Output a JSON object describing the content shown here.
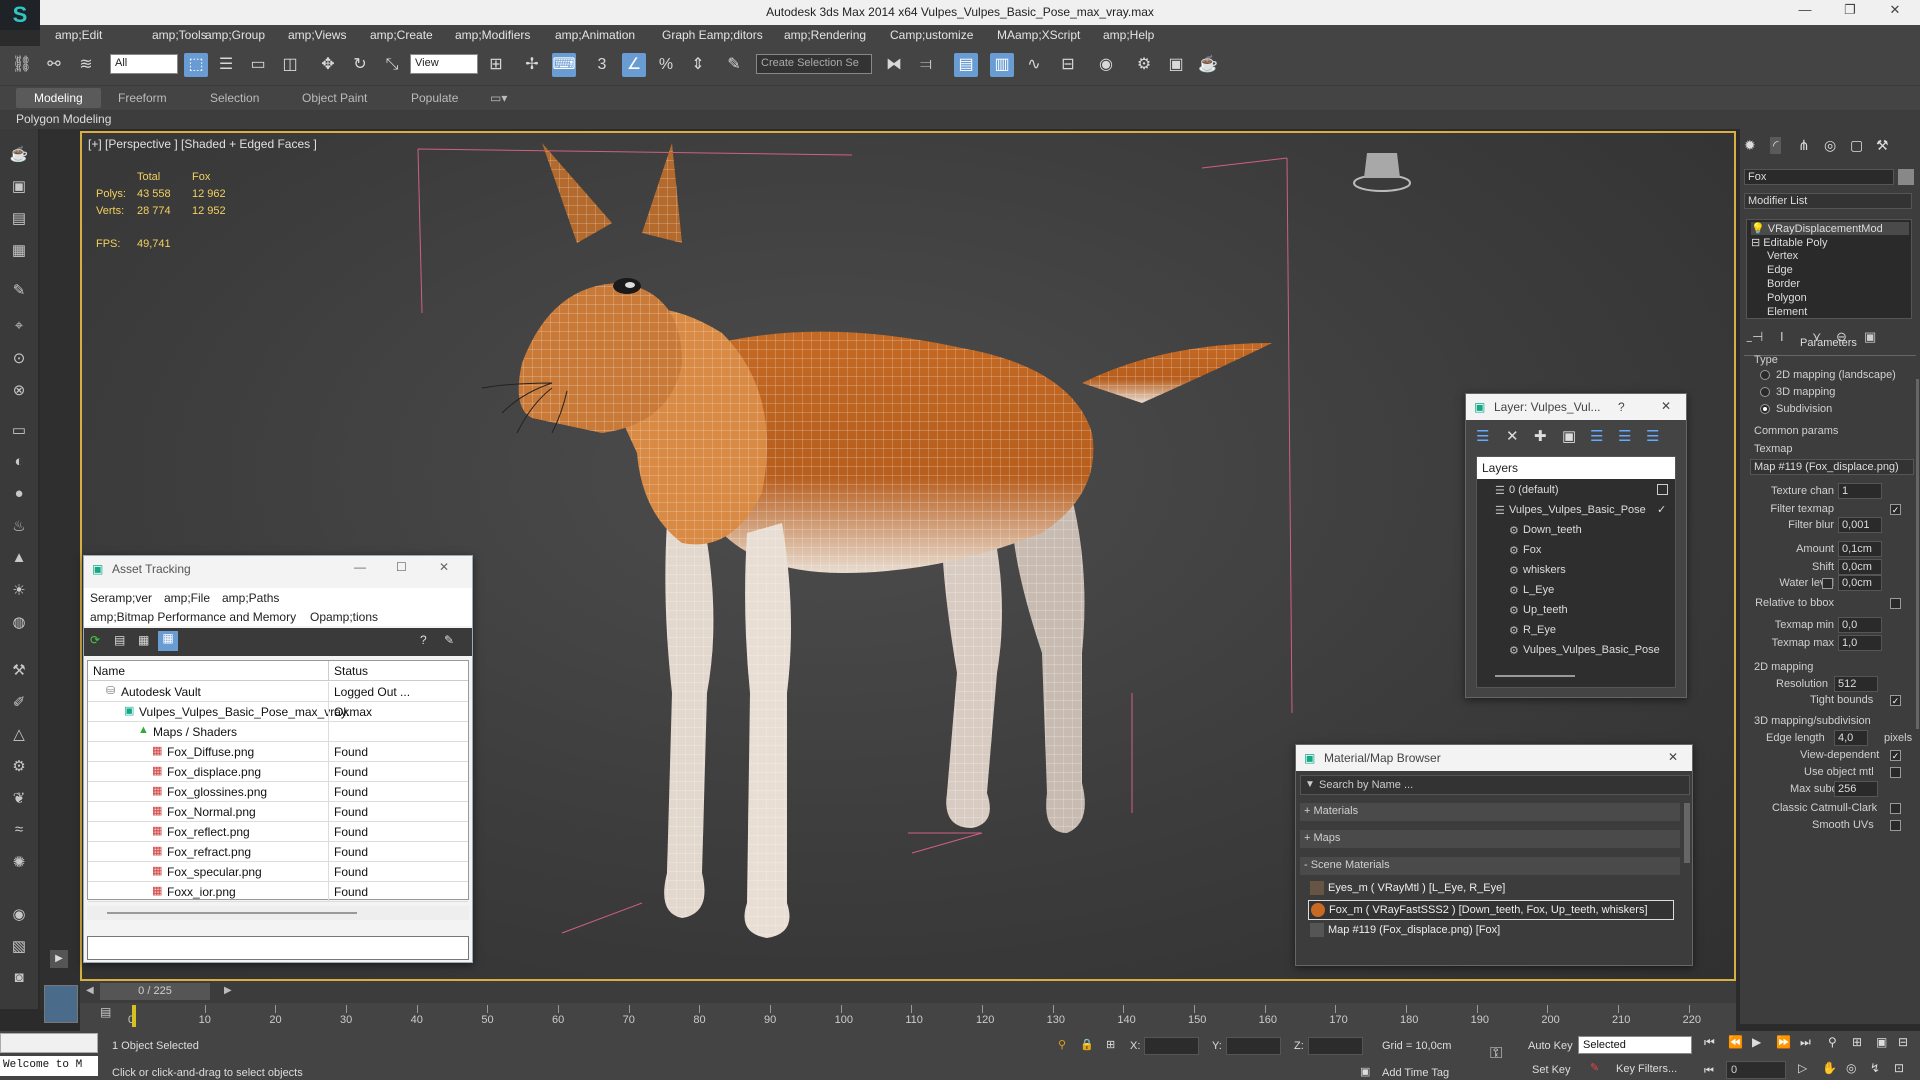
{
  "window": {
    "title": "Autodesk 3ds Max  2014 x64     Vulpes_Vulpes_Basic_Pose_max_vray.max",
    "logo": "3ds-max-logo-icon"
  },
  "menu": [
    "amp;Edit",
    "amp;Tools",
    "amp;Group",
    "amp;Views",
    "amp;Create",
    "amp;Modifiers",
    "amp;Animation",
    "Graph Eamp;ditors",
    "amp;Rendering",
    "Camp;ustomize",
    "MAamp;XScript",
    "amp;Help"
  ],
  "toolbar": {
    "filter": "All",
    "refcoord": "View",
    "selset": "Create Selection Se"
  },
  "ribbon": {
    "tabs": [
      "Modeling",
      "Freeform",
      "Selection",
      "Object Paint",
      "Populate"
    ],
    "sub": "Polygon Modeling"
  },
  "viewport": {
    "label": "[+] [Perspective ] [Shaded + Edged Faces ]",
    "stats": {
      "col1": "Total",
      "col2": "Fox",
      "polys_label": "Polys:",
      "polys_total": "43 558",
      "polys_fox": "12 962",
      "verts_label": "Verts:",
      "verts_total": "28 774",
      "verts_fox": "12 952",
      "fps_label": "FPS:",
      "fps": "49,741"
    }
  },
  "asset_tracking": {
    "title": "Asset Tracking",
    "menus": [
      "Seramp;ver",
      "amp;File",
      "amp;Paths",
      "amp;Bitmap Performance and Memory",
      "Opamp;tions"
    ],
    "columns": [
      "Name",
      "Status"
    ],
    "rows": [
      {
        "name": "Autodesk Vault",
        "status": "Logged Out ..."
      },
      {
        "name": "Vulpes_Vulpes_Basic_Pose_max_vray.max",
        "status": "Ok"
      },
      {
        "name": "Maps / Shaders",
        "status": ""
      },
      {
        "name": "Fox_Diffuse.png",
        "status": "Found"
      },
      {
        "name": "Fox_displace.png",
        "status": "Found"
      },
      {
        "name": "Fox_glossines.png",
        "status": "Found"
      },
      {
        "name": "Fox_Normal.png",
        "status": "Found"
      },
      {
        "name": "Fox_reflect.png",
        "status": "Found"
      },
      {
        "name": "Fox_refract.png",
        "status": "Found"
      },
      {
        "name": "Fox_specular.png",
        "status": "Found"
      },
      {
        "name": "Foxx_ior.png",
        "status": "Found"
      }
    ]
  },
  "layer_dialog": {
    "title": "Layer: Vulpes_Vul...",
    "help": "?",
    "header": "Layers",
    "items": [
      "0 (default)",
      "Vulpes_Vulpes_Basic_Pose",
      "Down_teeth",
      "Fox",
      "whiskers",
      "L_Eye",
      "Up_teeth",
      "R_Eye",
      "Vulpes_Vulpes_Basic_Pose"
    ]
  },
  "material_browser": {
    "title": "Material/Map Browser",
    "search_placeholder": "Search by Name ...",
    "groups": [
      "+ Materials",
      "+ Maps",
      "- Scene Materials"
    ],
    "items": [
      "Eyes_m  ( VRayMtl ) [L_Eye, R_Eye]",
      "Fox_m  ( VRayFastSSS2 ) [Down_teeth, Fox, Up_teeth, whiskers]",
      "Map #119 (Fox_displace.png) [Fox]"
    ]
  },
  "command_panel": {
    "object_name": "Fox",
    "modifier_list": "Modifier List",
    "stack": [
      "VRayDisplacementMod",
      "Editable Poly",
      "Vertex",
      "Edge",
      "Border",
      "Polygon",
      "Element"
    ],
    "rollout": "Parameters",
    "type_label": "Type",
    "types": [
      "2D mapping (landscape)",
      "3D mapping",
      "Subdivision"
    ],
    "common": "Common params",
    "texmap_label": "Texmap",
    "texmap": "Map #119 (Fox_displace.png)",
    "fields": [
      {
        "label": "Texture chan",
        "value": "1"
      },
      {
        "label": "Filter texmap",
        "value": ""
      },
      {
        "label": "Filter blur",
        "value": "0,001"
      },
      {
        "label": "Amount",
        "value": "0,1cm"
      },
      {
        "label": "Shift",
        "value": "0,0cm"
      },
      {
        "label": "Water level",
        "value": "0,0cm"
      },
      {
        "label": "Relative to bbox",
        "value": ""
      },
      {
        "label": "Texmap min",
        "value": "0,0"
      },
      {
        "label": "Texmap max",
        "value": "1,0"
      }
    ],
    "map2d": "2D mapping",
    "resolution_label": "Resolution",
    "resolution": "512",
    "tight": "Tight bounds",
    "map3d": "3D mapping/subdivision",
    "edge_label": "Edge length",
    "edge": "4,0",
    "pixels": "pixels",
    "viewdep": "View-dependent",
    "useobj": "Use object mtl",
    "maxsub_label": "Max subdivs",
    "maxsub": "256",
    "catmull": "Classic Catmull-Clark",
    "smooth": "Smooth UVs"
  },
  "timeline": {
    "frame": "0 / 225",
    "ticks": [
      "0",
      "10",
      "20",
      "30",
      "40",
      "50",
      "60",
      "70",
      "80",
      "90",
      "100",
      "110",
      "120",
      "130",
      "140",
      "150",
      "160",
      "170",
      "180",
      "190",
      "200",
      "210",
      "220"
    ]
  },
  "status": {
    "welcome": "Welcome to M",
    "selected": "1 Object Selected",
    "prompt": "Click or click-and-drag to select objects",
    "x_label": "X:",
    "y_label": "Y:",
    "z_label": "Z:",
    "grid": "Grid = 10,0cm",
    "addtime": "Add Time Tag",
    "autokey": "Auto Key",
    "setkey": "Set Key",
    "keymode": "Selected",
    "keyfilters": "Key Filters...",
    "frame": "0"
  }
}
